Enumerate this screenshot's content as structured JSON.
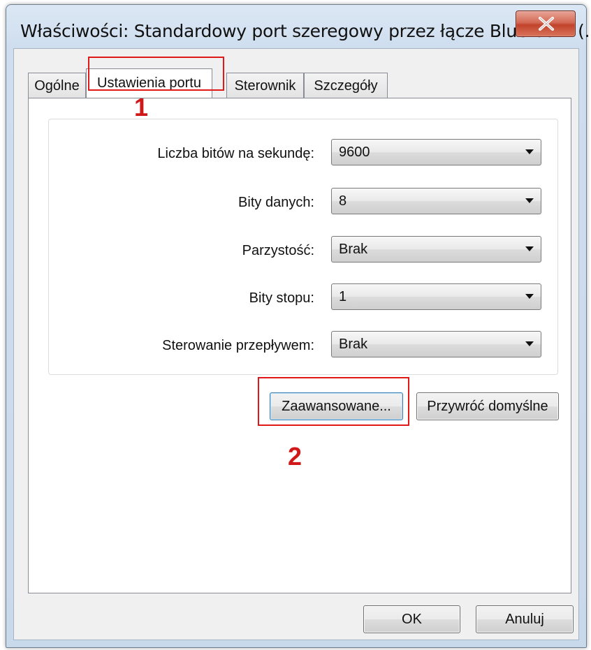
{
  "window": {
    "title": "Właściwości: Standardowy port szeregowy przez łącze Bluetooth (..."
  },
  "tabs": [
    {
      "label": "Ogólne",
      "active": false
    },
    {
      "label": "Ustawienia portu",
      "active": true
    },
    {
      "label": "Sterownik",
      "active": false
    },
    {
      "label": "Szczegóły",
      "active": false
    }
  ],
  "port_settings": {
    "fields": [
      {
        "label": "Liczba bitów na sekundę:",
        "value": "9600"
      },
      {
        "label": "Bity danych:",
        "value": "8"
      },
      {
        "label": "Parzystość:",
        "value": "Brak"
      },
      {
        "label": "Bity stopu:",
        "value": "1"
      },
      {
        "label": "Sterowanie przepływem:",
        "value": "Brak"
      }
    ],
    "advanced_label": "Zaawansowane...",
    "restore_defaults_label": "Przywróć domyślne"
  },
  "footer": {
    "ok_label": "OK",
    "cancel_label": "Anuluj"
  },
  "annotations": [
    {
      "number": "1"
    },
    {
      "number": "2"
    }
  ],
  "colors": {
    "annotation": "#e01818",
    "close_button": "#c1432b"
  },
  "icons": {
    "close": "close-icon"
  }
}
